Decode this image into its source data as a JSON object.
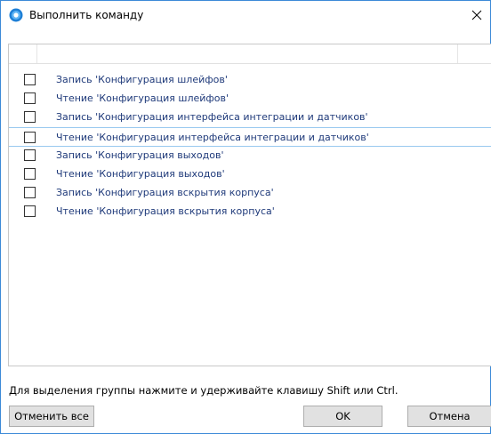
{
  "window": {
    "title": "Выполнить команду",
    "close_glyph": "✕"
  },
  "list": {
    "items": [
      {
        "label": "Запись 'Конфигурация шлейфов'",
        "checked": false,
        "selected": false
      },
      {
        "label": "Чтение 'Конфигурация шлейфов'",
        "checked": false,
        "selected": false
      },
      {
        "label": "Запись 'Конфигурация интерфейса интеграции и датчиков'",
        "checked": false,
        "selected": false
      },
      {
        "label": "Чтение 'Конфигурация интерфейса интеграции и датчиков'",
        "checked": false,
        "selected": true
      },
      {
        "label": "Запись 'Конфигурация выходов'",
        "checked": false,
        "selected": false
      },
      {
        "label": "Чтение 'Конфигурация выходов'",
        "checked": false,
        "selected": false
      },
      {
        "label": "Запись 'Конфигурация вскрытия корпуса'",
        "checked": false,
        "selected": false
      },
      {
        "label": "Чтение 'Конфигурация вскрытия корпуса'",
        "checked": false,
        "selected": false
      }
    ]
  },
  "footer": {
    "hint": "Для выделения группы нажмите и удерживайте клавишу Shift или Ctrl.",
    "deselect_all_label": "Отменить все",
    "ok_label": "OK",
    "cancel_label": "Отмена"
  },
  "colors": {
    "accent": "#3c8ad8",
    "item_text": "#1f3a7a",
    "selection_border": "#99c9ef"
  }
}
